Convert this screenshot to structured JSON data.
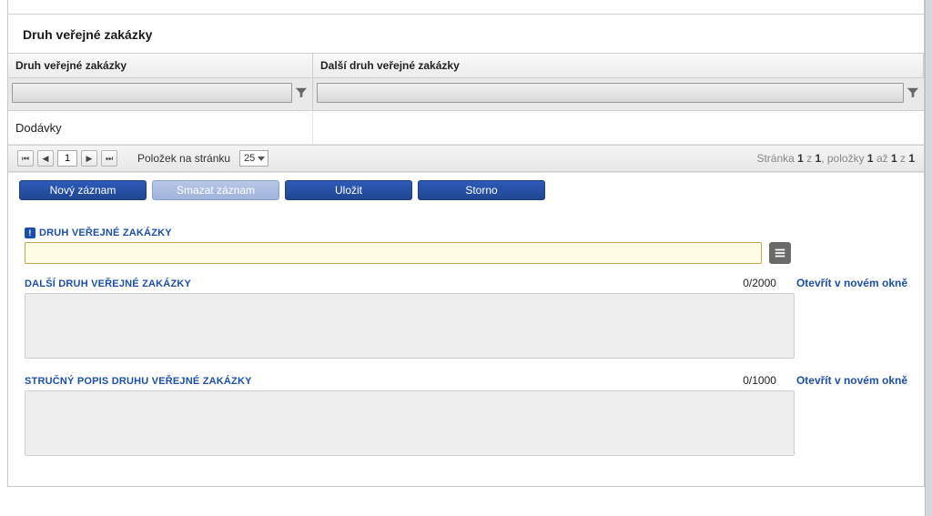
{
  "section": {
    "title": "Druh veřejné zakázky"
  },
  "grid": {
    "headers": {
      "a": "Druh veřejné zakázky",
      "b": "Další druh veřejné zakázky"
    },
    "rows": [
      {
        "a": "Dodávky",
        "b": ""
      }
    ]
  },
  "pager": {
    "page": "1",
    "per_page_label": "Položek na stránku",
    "per_page_value": "25",
    "status_prefix": "Stránka ",
    "page_cur": "1",
    "status_mid1": " z ",
    "page_total": "1",
    "status_mid2": ", položky ",
    "item_from": "1",
    "status_mid3": " až ",
    "item_to": "1",
    "status_mid4": " z ",
    "item_total": "1"
  },
  "buttons": {
    "new": "Nový záznam",
    "delete": "Smazat záznam",
    "save": "Uložit",
    "cancel": "Storno"
  },
  "fields": {
    "type": {
      "label": "DRUH VEŘEJNÉ ZAKÁZKY"
    },
    "other": {
      "label": "DALŠÍ DRUH VEŘEJNÉ ZAKÁZKY",
      "counter": "0/2000",
      "open": "Otevřít v novém okně"
    },
    "desc": {
      "label": "STRUČNÝ POPIS DRUHU VEŘEJNÉ ZAKÁZKY",
      "counter": "0/1000",
      "open": "Otevřít v novém okně"
    }
  }
}
